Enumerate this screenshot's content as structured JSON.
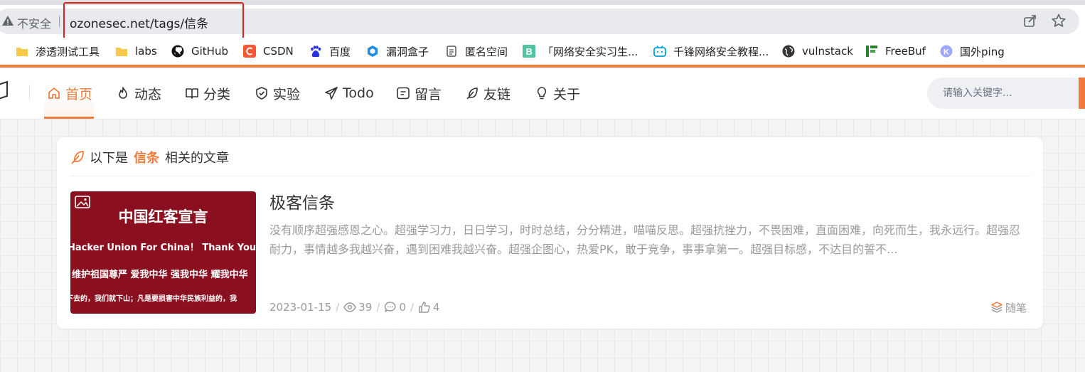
{
  "browser": {
    "security_label": "不安全",
    "url": "ozonesec.net/tags/信条",
    "icons": [
      "warning-icon",
      "share-icon",
      "star-icon"
    ],
    "highlight_color": "#e0201b"
  },
  "bookmarks": [
    {
      "label": "渗透测试工具",
      "icon": "folder-icon"
    },
    {
      "label": "labs",
      "icon": "folder-icon"
    },
    {
      "label": "GitHub",
      "icon": "github-icon"
    },
    {
      "label": "CSDN",
      "icon": "csdn-icon"
    },
    {
      "label": "百度",
      "icon": "baidu-icon"
    },
    {
      "label": "漏洞盒子",
      "icon": "hexagon-icon"
    },
    {
      "label": "匿名空间",
      "icon": "doc-icon"
    },
    {
      "label": "「网络安全实习生...",
      "icon": "b-icon"
    },
    {
      "label": "千锋网络安全教程...",
      "icon": "bilibili-icon"
    },
    {
      "label": "vulnstack",
      "icon": "globe-icon"
    },
    {
      "label": "FreeBuf",
      "icon": "freebuf-icon"
    },
    {
      "label": "国外ping",
      "icon": "k-icon"
    }
  ],
  "nav": {
    "items": [
      {
        "label": "首页",
        "icon": "home-icon",
        "active": true
      },
      {
        "label": "动态",
        "icon": "flame-icon"
      },
      {
        "label": "分类",
        "icon": "book-icon"
      },
      {
        "label": "实验",
        "icon": "shield-icon"
      },
      {
        "label": "Todo",
        "icon": "send-icon"
      },
      {
        "label": "留言",
        "icon": "message-icon"
      },
      {
        "label": "友链",
        "icon": "feather-icon"
      },
      {
        "label": "关于",
        "icon": "bulb-icon"
      }
    ],
    "search_placeholder": "请输入关键字..."
  },
  "card": {
    "heading_prefix": "以下是",
    "tag": "信条",
    "heading_suffix": "相关的文章",
    "post": {
      "title": "极客信条",
      "excerpt": "没有顺序超强感恩之心。超强学习力，日日学习，时时总结，分分精进，喵喵反思。超强抗挫力，不畏困难，直面困难，向死而生，我永远行。超强忍耐力，事情越多我越兴奋，遇到困难我越兴奋。超强企图心，热爱PK，敢于竞争，事事拿第一。超强目标感，不达目的誓不...",
      "date": "2023-01-15",
      "views": "39",
      "comments": "0",
      "likes": "4",
      "category": "随笔",
      "thumbnail": {
        "title": "中国红客宣言",
        "line1": "Hacker Union For China！ Thank You For",
        "line2": "维护祖国尊严 爱我中华 强我中华 耀我中华",
        "line3": "下去的，我们就下山；凡是要损害中华民族利益的，我",
        "bg_color": "#8a0f1f"
      }
    }
  },
  "accent_color": "#f07a3a"
}
